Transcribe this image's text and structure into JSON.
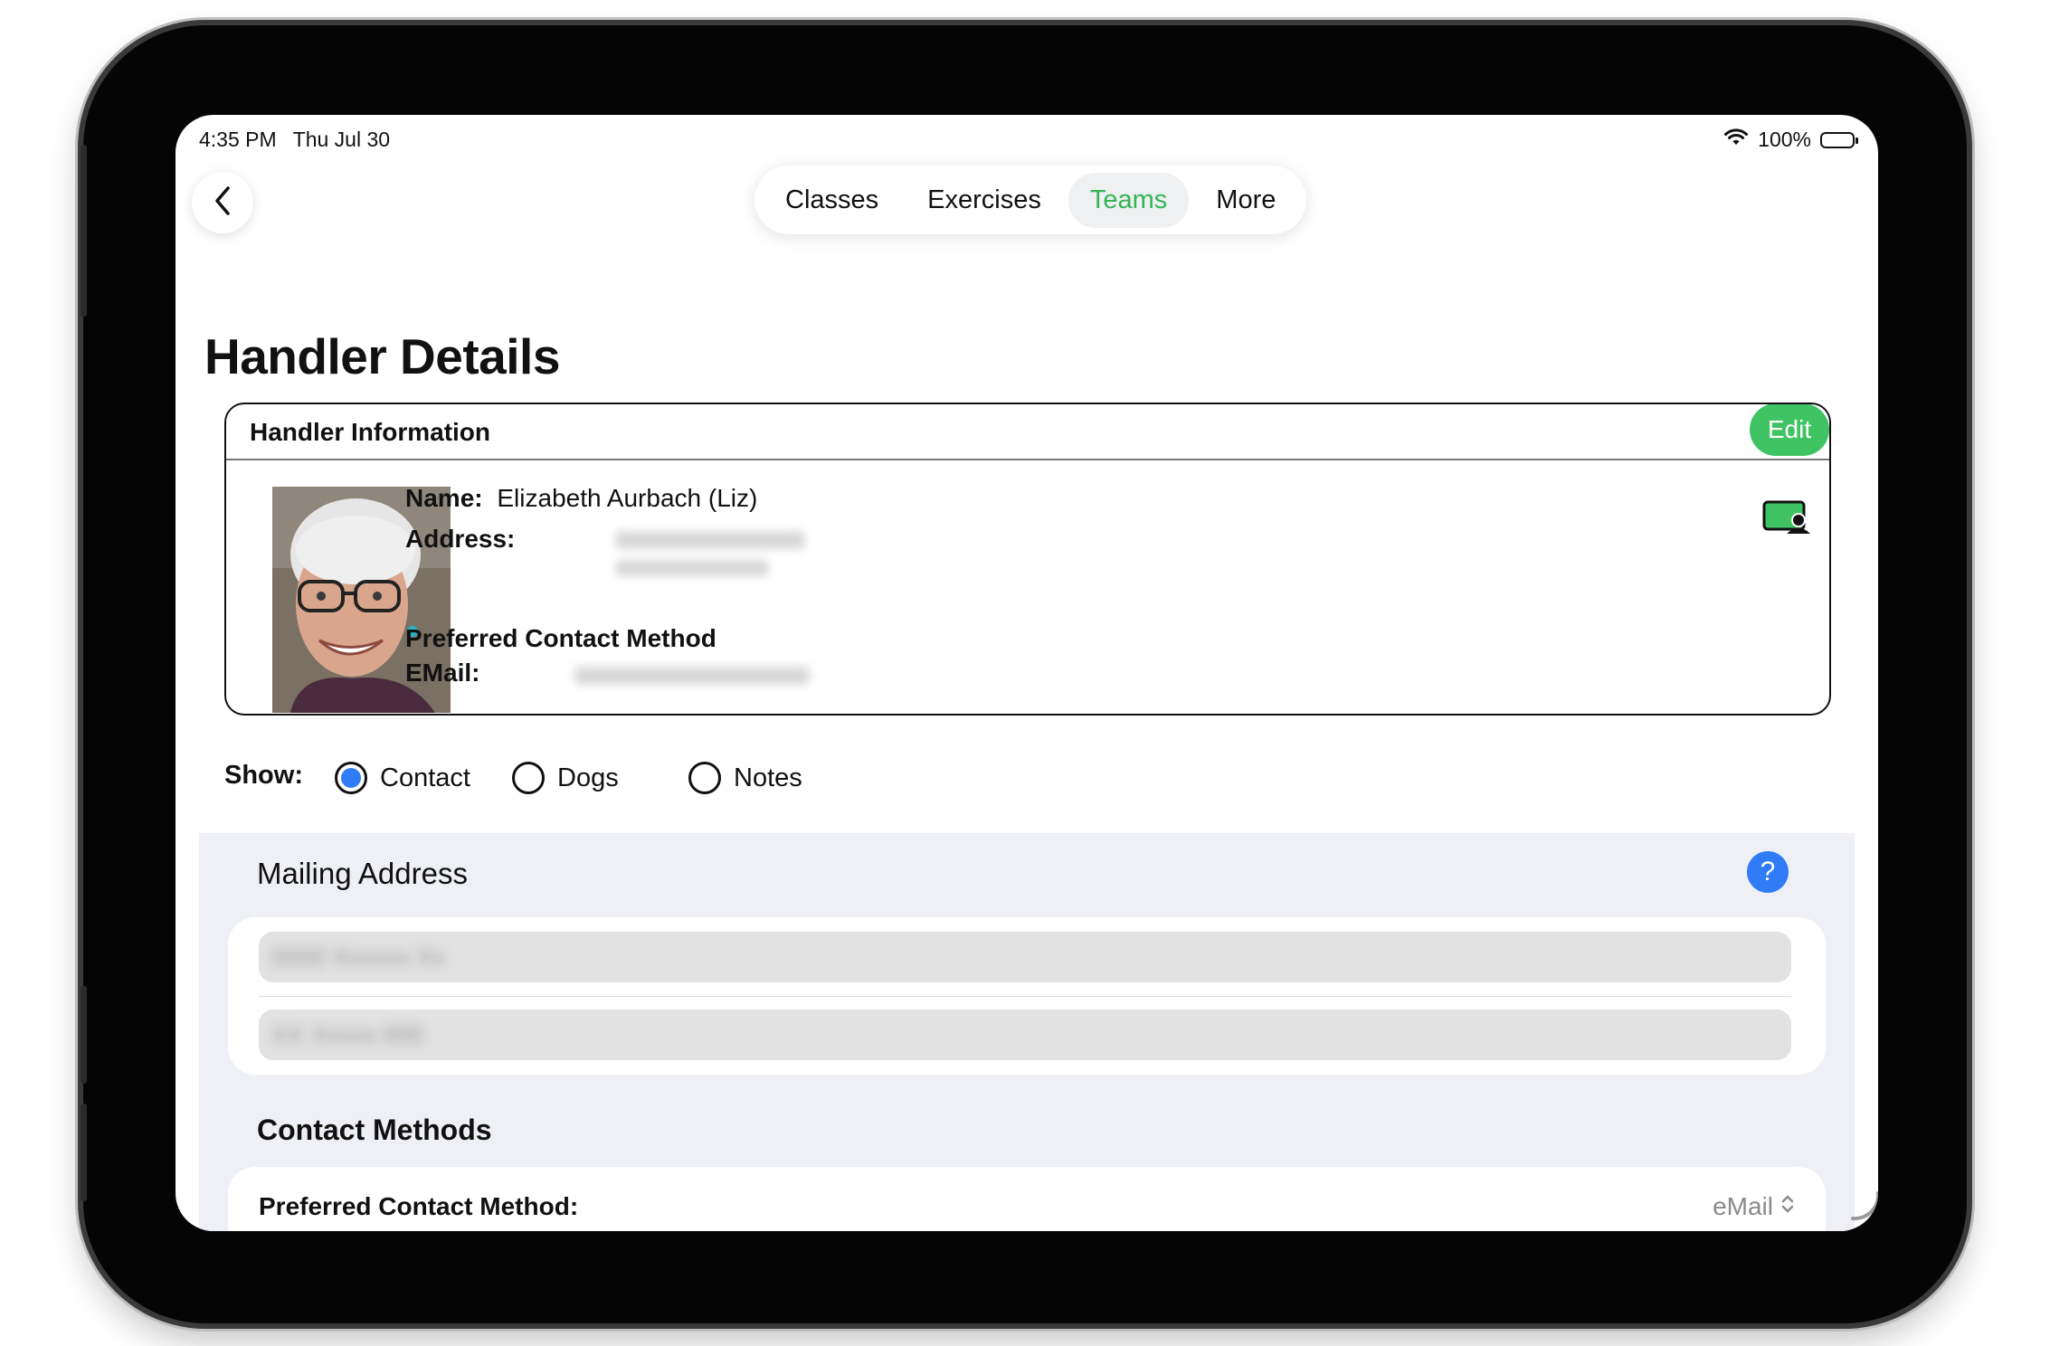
{
  "status_bar": {
    "time": "4:35 PM",
    "date": "Thu Jul 30",
    "battery": "100%"
  },
  "nav": {
    "tabs": [
      {
        "label": "Classes"
      },
      {
        "label": "Exercises"
      },
      {
        "label": "Teams"
      },
      {
        "label": "More"
      }
    ],
    "active_tab": "Teams"
  },
  "page": {
    "title": "Handler Details"
  },
  "handler_card": {
    "title": "Handler Information",
    "edit_label": "Edit",
    "name_label": "Name:",
    "name_value": "Elizabeth Aurbach  (Liz)",
    "address_label": "Address:",
    "preferred_label": "Preferred Contact Method",
    "email_label": "EMail:"
  },
  "show": {
    "label": "Show:",
    "options": [
      {
        "label": "Contact",
        "checked": true
      },
      {
        "label": "Dogs",
        "checked": false
      },
      {
        "label": "Notes",
        "checked": false
      }
    ]
  },
  "mailing_address": {
    "title": "Mailing Address",
    "help": "?"
  },
  "contact_methods": {
    "title": "Contact Methods",
    "preferred_label": "Preferred Contact Method:",
    "preferred_value": "eMail"
  },
  "colors": {
    "accent_green": "#40c463",
    "tab_active_text": "#34b554",
    "radio_blue": "#2f7cf6"
  }
}
